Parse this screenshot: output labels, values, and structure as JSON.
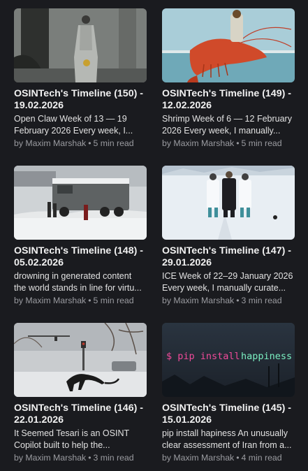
{
  "cards": [
    {
      "title_l1": "OSINTech's Timeline (150) -",
      "title_l2": "19.02.2026",
      "excerpt_l1": "Open Claw Week of 13 — 19",
      "excerpt_l2": "February 2026 Every week, I...",
      "author": "by Maxim Marshak",
      "sep": "•",
      "read": "5 min read"
    },
    {
      "title_l1": "OSINTech's Timeline (149) -",
      "title_l2": "12.02.2026",
      "excerpt_l1": "Shrimp Week of 6 — 12 February",
      "excerpt_l2": "2026 Every week, I manually...",
      "author": "by Maxim Marshak",
      "sep": "•",
      "read": "5 min read"
    },
    {
      "title_l1": "OSINTech's Timeline (148) -",
      "title_l2": "05.02.2026",
      "excerpt_l1": "drowning in generated content",
      "excerpt_l2": "the world stands in line for virtu...",
      "author": "by Maxim Marshak",
      "sep": "•",
      "read": "5 min read"
    },
    {
      "title_l1": "OSINTech's Timeline (147) -",
      "title_l2": "29.01.2026",
      "excerpt_l1": "ICE Week of 22–29 January 2026",
      "excerpt_l2": "Every week, I manually curate...",
      "author": "by Maxim Marshak",
      "sep": "•",
      "read": "3 min read"
    },
    {
      "title_l1": "OSINTech's Timeline (146) -",
      "title_l2": "22.01.2026",
      "excerpt_l1": "It Seemed Tesari is an OSINT",
      "excerpt_l2": "Copilot built to help the...",
      "author": "by Maxim Marshak",
      "sep": "•",
      "read": "3 min read"
    },
    {
      "title_l1": "OSINTech's Timeline (145) -",
      "title_l2": "15.01.2026",
      "excerpt_l1": "pip install hapiness An unusually",
      "excerpt_l2": "clear assessment of Iran from a...",
      "author": "by Maxim Marshak",
      "sep": "•",
      "read": "4 min read",
      "image_text_prompt": "$ pip install",
      "image_text_word": "happiness"
    }
  ]
}
